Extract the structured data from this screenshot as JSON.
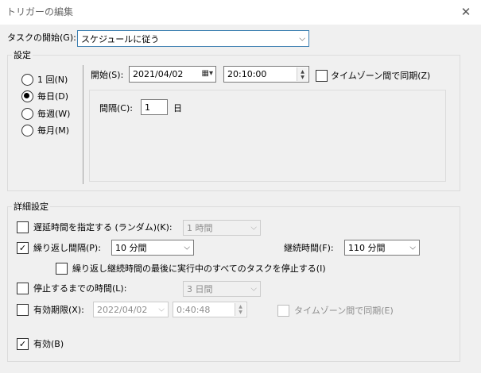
{
  "window": {
    "title": "トリガーの編集",
    "close_glyph": "✕"
  },
  "start_task": {
    "label": "タスクの開始(G):",
    "value": "スケジュールに従う"
  },
  "settings": {
    "group_label": "設定",
    "radios": [
      {
        "label": "1 回(N)",
        "selected": false
      },
      {
        "label": "毎日(D)",
        "selected": true
      },
      {
        "label": "毎週(W)",
        "selected": false
      },
      {
        "label": "毎月(M)",
        "selected": false
      }
    ],
    "start_label": "開始(S):",
    "start_date": "2021/04/02",
    "start_time": "20:10:00",
    "sync_timezone_label": "タイムゾーン間で同期(Z)",
    "interval_label": "間隔(C):",
    "interval_value": "1",
    "interval_unit": "日"
  },
  "advanced": {
    "group_label": "詳細設定",
    "delay": {
      "label": "遅延時間を指定する (ランダム)(K):",
      "value": "1 時間",
      "checked": false
    },
    "repeat": {
      "label": "繰り返し間隔(P):",
      "value": "10 分間",
      "checked": true
    },
    "duration": {
      "label": "継続時間(F):",
      "value": "110 分間"
    },
    "stop_all": {
      "label": "繰り返し継続時間の最後に実行中のすべてのタスクを停止する(I)",
      "checked": false
    },
    "stop_after": {
      "label": "停止するまでの時間(L):",
      "value": "3 日間",
      "checked": false
    },
    "expire": {
      "label": "有効期限(X):",
      "date": "2022/04/02",
      "time": "0:40:48",
      "checked": false,
      "sync_label": "タイムゾーン間で同期(E)"
    },
    "enabled": {
      "label": "有効(B)",
      "checked": true
    }
  },
  "glyphs": {
    "check": "✓",
    "chevron": "⌵",
    "calendar": "▦▾",
    "spin_up": "▲",
    "spin_down": "▼"
  }
}
